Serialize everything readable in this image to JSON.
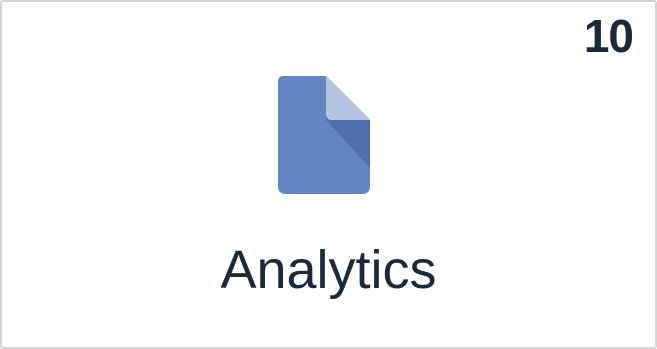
{
  "tile": {
    "count": "10",
    "label": "Analytics",
    "icon": "document-icon",
    "colors": {
      "icon_body": "#6286c4",
      "icon_fold_light": "#b4c4e0",
      "icon_fold_dark": "#4d6fae",
      "text": "#1b2a3a",
      "border": "#d4d4d4"
    }
  }
}
